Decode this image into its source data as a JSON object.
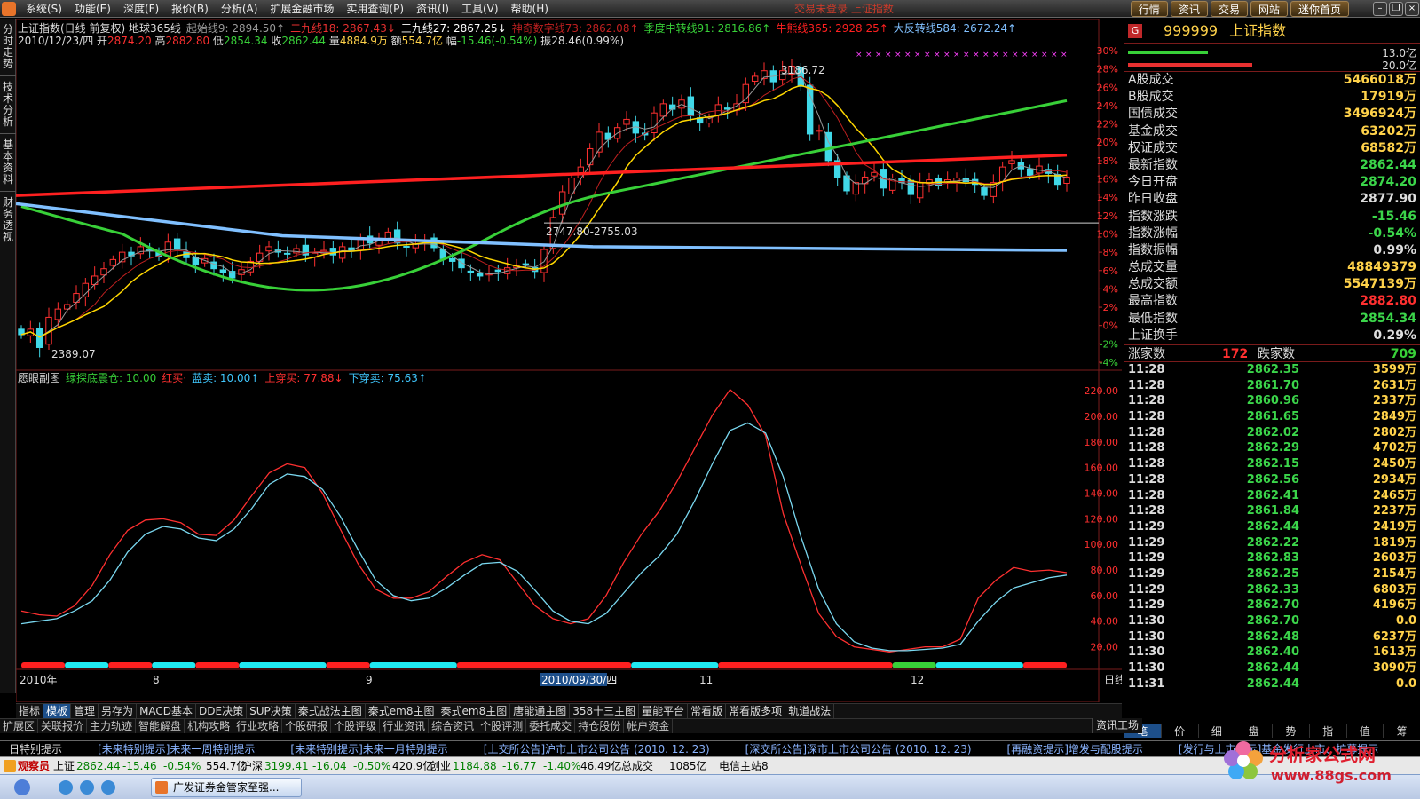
{
  "menubar": {
    "items": [
      "系统(S)",
      "功能(E)",
      "深度(F)",
      "报价(B)",
      "分析(A)",
      "扩展金融市场",
      "实用查询(P)",
      "资讯(I)",
      "工具(V)",
      "帮助(H)"
    ],
    "notice": "交易未登录 上证指数",
    "quick_buttons": [
      "行情",
      "资讯",
      "交易",
      "网站",
      "迷你首页"
    ]
  },
  "left_tabs": [
    "分时走势",
    "技术分析",
    "基本资料",
    "财务透视"
  ],
  "chart": {
    "header1": [
      {
        "text": "上证指数(日线 前复权) 地球365线",
        "color": "#dddddd"
      },
      {
        "text": "起始线9: 2894.50↑",
        "color": "#9a9a9a"
      },
      {
        "text": "二九线18: 2867.43↓",
        "color": "#e83030"
      },
      {
        "text": "三九线27: 2867.25↓",
        "color": "#ffffff"
      },
      {
        "text": "神奇数字线73: 2862.08↑",
        "color": "#c02020"
      },
      {
        "text": "季度中转线91: 2816.86↑",
        "color": "#38d038"
      },
      {
        "text": "牛熊线365: 2928.25↑",
        "color": "#ff2020"
      },
      {
        "text": "大反转线584: 2672.24↑",
        "color": "#80c0ff"
      }
    ],
    "header2": [
      {
        "text": "2010/12/23/四 开",
        "color": "#dddddd"
      },
      {
        "text": "2874.20",
        "color": "#ff3030"
      },
      {
        "text": " 高",
        "color": "#dddddd"
      },
      {
        "text": "2882.80",
        "color": "#ff3030"
      },
      {
        "text": " 低",
        "color": "#dddddd"
      },
      {
        "text": "2854.34",
        "color": "#38d038"
      },
      {
        "text": " 收",
        "color": "#dddddd"
      },
      {
        "text": "2862.44",
        "color": "#38d038"
      },
      {
        "text": " 量",
        "color": "#dddddd"
      },
      {
        "text": "4884.9万",
        "color": "#ffd24a"
      },
      {
        "text": " 额",
        "color": "#dddddd"
      },
      {
        "text": "554.7亿",
        "color": "#ffd24a"
      },
      {
        "text": " 幅",
        "color": "#dddddd"
      },
      {
        "text": "-15.46(-0.54%)",
        "color": "#38d038"
      },
      {
        "text": " 振",
        "color": "#dddddd"
      },
      {
        "text": "28.46(0.99%)",
        "color": "#dddddd"
      }
    ],
    "annotations": {
      "high": "3186.72",
      "low": "2389.07",
      "range": "2747.80-2755.03"
    },
    "pct_axis": [
      "30%",
      "28%",
      "26%",
      "24%",
      "22%",
      "20%",
      "18%",
      "16%",
      "14%",
      "12%",
      "10%",
      "8%",
      "6%",
      "4%",
      "2%",
      "0%",
      "-2%",
      "-4%"
    ],
    "sub_header": [
      {
        "text": "愿眼副图",
        "color": "#dddddd"
      },
      {
        "text": "绿探底震仓: 10.00",
        "color": "#38d038"
      },
      {
        "text": "红买·",
        "color": "#ff3030"
      },
      {
        "text": "蓝卖: 10.00↑",
        "color": "#40c8ff"
      },
      {
        "text": "上穿买: 77.88↓",
        "color": "#ff3030"
      },
      {
        "text": "下穿卖: 75.63↑",
        "color": "#40c8ff"
      }
    ],
    "sub_axis": [
      "220.00",
      "200.00",
      "180.00",
      "160.00",
      "140.00",
      "120.00",
      "100.00",
      "80.00",
      "60.00",
      "40.00",
      "20.00"
    ],
    "x_labels": [
      "2010年",
      "8",
      "9",
      "11",
      "12"
    ],
    "cursor_date": "2010/09/30/四",
    "period": "日线"
  },
  "chart_data": [
    {
      "type": "candlestick",
      "title": "上证指数(日线 前复权)",
      "ylim_pct": [
        -4,
        30
      ],
      "last_bar": {
        "date": "2010/12/23",
        "open": 2874.2,
        "high": 2882.8,
        "low": 2854.34,
        "close": 2862.44,
        "volume": "4884.9万",
        "amount": "554.7亿"
      },
      "series": [
        {
          "name": "起始线9",
          "value": 2894.5
        },
        {
          "name": "二九线18",
          "value": 2867.43
        },
        {
          "name": "三九线27",
          "value": 2867.25
        },
        {
          "name": "神奇数字线73",
          "value": 2862.08
        },
        {
          "name": "季度中转线91",
          "value": 2816.86
        },
        {
          "name": "牛熊线365",
          "value": 2928.25
        },
        {
          "name": "大反转线584",
          "value": 2672.24
        }
      ],
      "close_pct": [
        -1.0,
        -0.4,
        -2.4,
        0.9,
        1.8,
        2.3,
        3.5,
        4.6,
        5.4,
        6.2,
        7.2,
        8.0,
        7.6,
        8.6,
        8.2,
        7.5,
        9.1,
        8.3,
        7.4,
        6.6,
        7.3,
        6.2,
        5.8,
        5.2,
        6.1,
        7.0,
        7.9,
        8.6,
        8.0,
        7.8,
        8.4,
        7.7,
        7.9,
        8.2,
        7.7,
        8.6,
        8.1,
        9.4,
        9.0,
        9.4,
        10.2,
        9.0,
        8.6,
        8.9,
        9.2,
        8.5,
        7.3,
        7.0,
        6.3,
        5.8,
        5.4,
        5.7,
        5.9,
        6.3,
        6.5,
        6.7,
        5.9,
        8.3,
        11.8,
        14.6,
        16.1,
        17.3,
        19.3,
        21.1,
        20.3,
        21.6,
        22.5,
        21.0,
        20.8,
        23.2,
        24.2,
        23.6,
        24.6,
        22.9,
        22.1,
        22.7,
        24.1,
        23.6,
        24.2,
        26.3,
        27.2,
        27.8,
        26.6,
        27.8,
        28.3,
        26.1,
        20.9,
        21.3,
        18.0,
        16.1,
        14.7,
        15.6,
        16.2,
        16.7,
        15.0,
        16.1,
        15.6,
        14.3,
        15.6,
        15.9,
        15.3,
        15.9,
        16.1,
        15.7,
        15.4,
        14.2,
        15.6,
        17.3,
        18.0,
        17.1,
        16.4,
        17.4,
        16.6,
        15.4,
        16.2
      ],
      "xlabels": [
        "2010年",
        "8",
        "9",
        "11",
        "12"
      ]
    },
    {
      "type": "line",
      "title": "愿眼副图",
      "ylim": [
        10,
        225
      ],
      "series": [
        {
          "name": "红买",
          "values": [
            48,
            45,
            44,
            52,
            68,
            92,
            111,
            119,
            120,
            117,
            108,
            107,
            119,
            138,
            156,
            163,
            160,
            140,
            112,
            85,
            65,
            58,
            58,
            63,
            75,
            86,
            92,
            88,
            70,
            52,
            42,
            38,
            42,
            60,
            86,
            108,
            126,
            149,
            175,
            201,
            221,
            209,
            185,
            124,
            84,
            46,
            28,
            20,
            18,
            16,
            18,
            20,
            20,
            26,
            58,
            72,
            82,
            79,
            80,
            78
          ]
        },
        {
          "name": "蓝卖",
          "values": [
            38,
            40,
            42,
            48,
            56,
            72,
            94,
            108,
            114,
            112,
            105,
            103,
            112,
            128,
            147,
            155,
            153,
            143,
            122,
            96,
            72,
            60,
            56,
            58,
            66,
            76,
            85,
            86,
            79,
            64,
            48,
            40,
            38,
            46,
            62,
            78,
            91,
            108,
            134,
            163,
            189,
            195,
            187,
            153,
            106,
            65,
            38,
            24,
            19,
            17,
            17,
            18,
            19,
            22,
            40,
            55,
            66,
            70,
            74,
            76
          ]
        }
      ]
    }
  ],
  "right_panel": {
    "code": "999999",
    "name": "上证指数",
    "bar1_val": "13.0亿",
    "bar2_val": "20.0亿",
    "stats": [
      {
        "label": "A股成交",
        "value": "5466018万",
        "color": "#ffd24a"
      },
      {
        "label": "B股成交",
        "value": "17919万",
        "color": "#ffd24a"
      },
      {
        "label": "国债成交",
        "value": "3496924万",
        "color": "#ffd24a"
      },
      {
        "label": "基金成交",
        "value": "63202万",
        "color": "#ffd24a"
      },
      {
        "label": "权证成交",
        "value": "68582万",
        "color": "#ffd24a"
      },
      {
        "label": "最新指数",
        "value": "2862.44",
        "color": "#3bd54a"
      },
      {
        "label": "今日开盘",
        "value": "2874.20",
        "color": "#3bd54a"
      },
      {
        "label": "昨日收盘",
        "value": "2877.90",
        "color": "#dddddd"
      },
      {
        "label": "指数涨跌",
        "value": "-15.46",
        "color": "#3bd54a"
      },
      {
        "label": "指数涨幅",
        "value": "-0.54%",
        "color": "#3bd54a"
      },
      {
        "label": "指数振幅",
        "value": "0.99%",
        "color": "#dddddd"
      },
      {
        "label": "总成交量",
        "value": "48849379",
        "color": "#ffd24a"
      },
      {
        "label": "总成交额",
        "value": "5547139万",
        "color": "#ffd24a"
      },
      {
        "label": "最高指数",
        "value": "2882.80",
        "color": "#ff3030"
      },
      {
        "label": "最低指数",
        "value": "2854.34",
        "color": "#3bd54a"
      },
      {
        "label": "上证换手",
        "value": "0.29%",
        "color": "#dddddd"
      }
    ],
    "breadth": {
      "up_label": "涨家数",
      "up": "172",
      "down_label": "跌家数",
      "down": "709"
    },
    "ticks": [
      {
        "t": "11:28",
        "p": "2862.35",
        "v": "3599万"
      },
      {
        "t": "11:28",
        "p": "2861.70",
        "v": "2631万"
      },
      {
        "t": "11:28",
        "p": "2860.96",
        "v": "2337万"
      },
      {
        "t": "11:28",
        "p": "2861.65",
        "v": "2849万"
      },
      {
        "t": "11:28",
        "p": "2862.02",
        "v": "2802万"
      },
      {
        "t": "11:28",
        "p": "2862.29",
        "v": "4702万"
      },
      {
        "t": "11:28",
        "p": "2862.15",
        "v": "2450万"
      },
      {
        "t": "11:28",
        "p": "2862.56",
        "v": "2934万"
      },
      {
        "t": "11:28",
        "p": "2862.41",
        "v": "2465万"
      },
      {
        "t": "11:28",
        "p": "2861.84",
        "v": "2237万"
      },
      {
        "t": "11:29",
        "p": "2862.44",
        "v": "2419万"
      },
      {
        "t": "11:29",
        "p": "2862.22",
        "v": "1819万"
      },
      {
        "t": "11:29",
        "p": "2862.83",
        "v": "2603万"
      },
      {
        "t": "11:29",
        "p": "2862.25",
        "v": "2154万"
      },
      {
        "t": "11:29",
        "p": "2862.33",
        "v": "6803万"
      },
      {
        "t": "11:29",
        "p": "2862.70",
        "v": "4196万"
      },
      {
        "t": "11:30",
        "p": "2862.70",
        "v": "0.0"
      },
      {
        "t": "11:30",
        "p": "2862.48",
        "v": "6237万"
      },
      {
        "t": "11:30",
        "p": "2862.40",
        "v": "1613万"
      },
      {
        "t": "11:30",
        "p": "2862.44",
        "v": "3090万"
      },
      {
        "t": "11:31",
        "p": "2862.44",
        "v": "0.0"
      }
    ],
    "tabs": [
      "笔",
      "价",
      "细",
      "盘",
      "势",
      "指",
      "值",
      "筹"
    ]
  },
  "tabs1": [
    "指标",
    "模板",
    "管理",
    "另存为",
    "MACD基本",
    "DDE决策",
    "SUP决策",
    "秦式战法主图",
    "秦式em8主图",
    "秦式em8主图",
    "唐能通主图",
    "358十三主图",
    "量能平台",
    "常看版",
    "常看版多项",
    "轨道战法"
  ],
  "tabs2": [
    "扩展区",
    "关联报价",
    "主力轨迹",
    "智能解盘",
    "机构攻略",
    "行业攻略",
    "个股研报",
    "个股评级",
    "行业资讯",
    "综合资讯",
    "个股评测",
    "委托成交",
    "持仓股份",
    "帐户资金"
  ],
  "tabs2_right": "资讯工场",
  "ticker": [
    "日特别提示",
    "[未来特别提示]未来一周特别提示",
    "[未来特别提示]未来一月特别提示",
    "[上交所公告]沪市上市公司公告 (2010. 12. 23)",
    "[深交所公告]深市上市公司公告 (2010. 12. 23)",
    "[再融资提示]增发与配股提示",
    "[发行与上市提示]基金发行上市、扩募提示"
  ],
  "statusbar": {
    "observer": "观察员",
    "sh_label": "上证",
    "sh_price": "2862.44",
    "sh_chg": "-15.46",
    "sh_pct": "-0.54%",
    "sh_amt": "554.7亿",
    "sz_label": "沪深",
    "sz_price": "3199.41",
    "sz_chg": "-16.04",
    "sz_pct": "-0.50%",
    "sz_amt": "420.9亿",
    "cy_label": "创业",
    "cy_price": "1184.88",
    "cy_chg": "-16.77",
    "cy_pct": "-1.40%",
    "cy_amt": "46.49亿",
    "total_label": "总成交",
    "total": "1085亿",
    "server": "电信主站8"
  },
  "taskbar": {
    "task": "广发证券金管家至强..."
  },
  "watermark": {
    "site": "分析家公式网",
    "url": "www.88gs.com"
  },
  "colors": {
    "up": "#ff3030",
    "down": "#38d038",
    "bull_bear": "#ff2020",
    "reversal": "#80c0ff",
    "quarter": "#38d038",
    "start": "#9a9a9a",
    "ma18": "#c02020",
    "ma27": "#ffd700"
  }
}
